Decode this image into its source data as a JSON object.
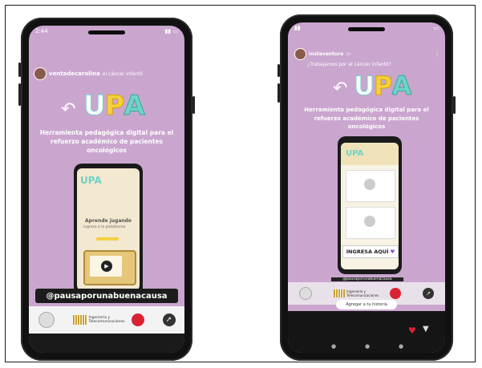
{
  "left_phone": {
    "status_time": "2:44",
    "username": "ventadecarolina",
    "reply_text": "el cáncer infantil",
    "logo": "UPA",
    "tagline": "Herramienta pedagógica digital para el refuerzo académico de pacientes oncológicos",
    "inner_logo": "UPA",
    "inner_title": "Aprende jugando",
    "inner_subtitle": "ingresa a la plataforma",
    "handle": "@pausaporunabuenacausa",
    "footer_label": "Ingeniería y Telecomunicaciones"
  },
  "right_phone": {
    "username": "instaventura",
    "time_ago": "1h",
    "reply_text": "¿Trabajamos por el cáncer infantil?",
    "logo": "UPA",
    "tagline": "Herramienta pedagógica digital para el refuerzo académico de pacientes oncológicos",
    "inner_logo": "UPA",
    "cta": "INGRESA AQUÍ",
    "inner_handle": "@pausaporunabuenacausa",
    "add_button": "Agregar a tu historia",
    "footer_label": "Ingeniería y Telecomunicaciones"
  },
  "colors": {
    "story_bg": "#caa6cf",
    "logo_yellow": "#f4d03f",
    "logo_pink": "#f06fb0",
    "logo_teal": "#6fd3c8",
    "accent_red": "#d92231"
  }
}
